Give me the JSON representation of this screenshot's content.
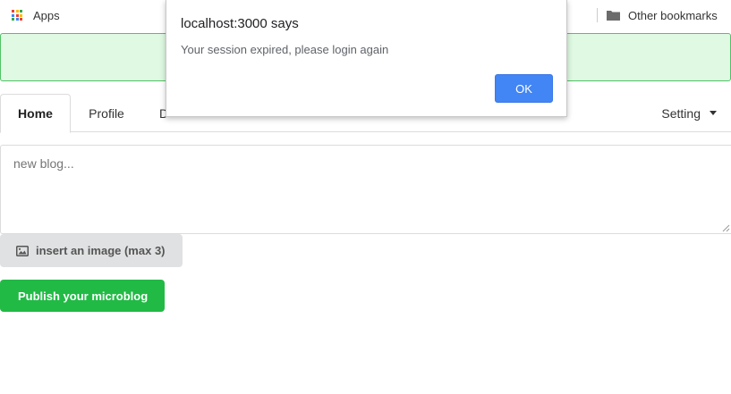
{
  "bookmarks_bar": {
    "apps_label": "Apps",
    "other_bookmarks_label": "Other bookmarks",
    "apps_grid_colors": [
      "#ea4335",
      "#fbbc05",
      "#34a853",
      "#4285f4",
      "#ea4335",
      "#fbbc05",
      "#34a853",
      "#4285f4",
      "#ea4335"
    ]
  },
  "nav": {
    "tabs": [
      {
        "label": "Home",
        "active": true
      },
      {
        "label": "Profile",
        "active": false
      },
      {
        "label": "D",
        "active": false
      }
    ],
    "setting_label": "Setting"
  },
  "composer": {
    "placeholder": "new blog...",
    "insert_image_label": "insert an image (max 3)",
    "publish_label": "Publish your microblog"
  },
  "alert_dialog": {
    "title": "localhost:3000 says",
    "message": "Your session expired, please login again",
    "ok_label": "OK"
  },
  "colors": {
    "success_green": "#21ba45",
    "alert_band_bg": "#dff9e2",
    "alert_band_border": "#52c266",
    "dialog_button_blue": "#4285f4"
  }
}
